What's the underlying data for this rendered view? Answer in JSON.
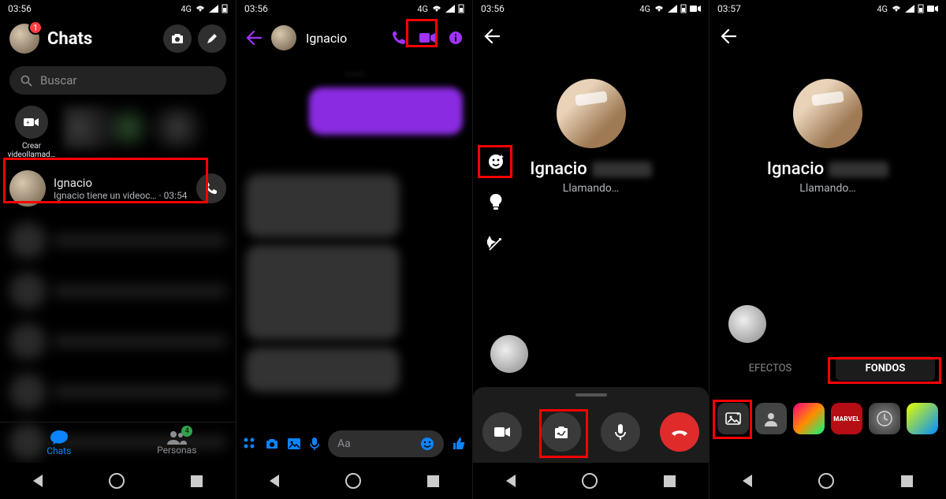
{
  "status": {
    "time1": "03:56",
    "time2": "03:56",
    "time3": "03:56",
    "time4": "03:57",
    "network": "4G"
  },
  "panel1": {
    "title": "Chats",
    "badge": "1",
    "search_placeholder": "Buscar",
    "create_call_label": "Crear videollamad…",
    "chat": {
      "name": "Ignacio",
      "subtitle": "Ignacio tiene un videoc…  · 03:54"
    },
    "tab_chats": "Chats",
    "tab_people": "Personas",
    "people_badge": "4"
  },
  "panel2": {
    "contact_name": "Ignacio",
    "input_placeholder": "Aa"
  },
  "panel3": {
    "name": "Ignacio",
    "status": "Llamando…"
  },
  "panel4": {
    "name": "Ignacio",
    "status": "Llamando…",
    "tab_effects": "EFECTOS",
    "tab_backgrounds": "FONDOS",
    "bg_marvel_label": "MARVEL"
  }
}
